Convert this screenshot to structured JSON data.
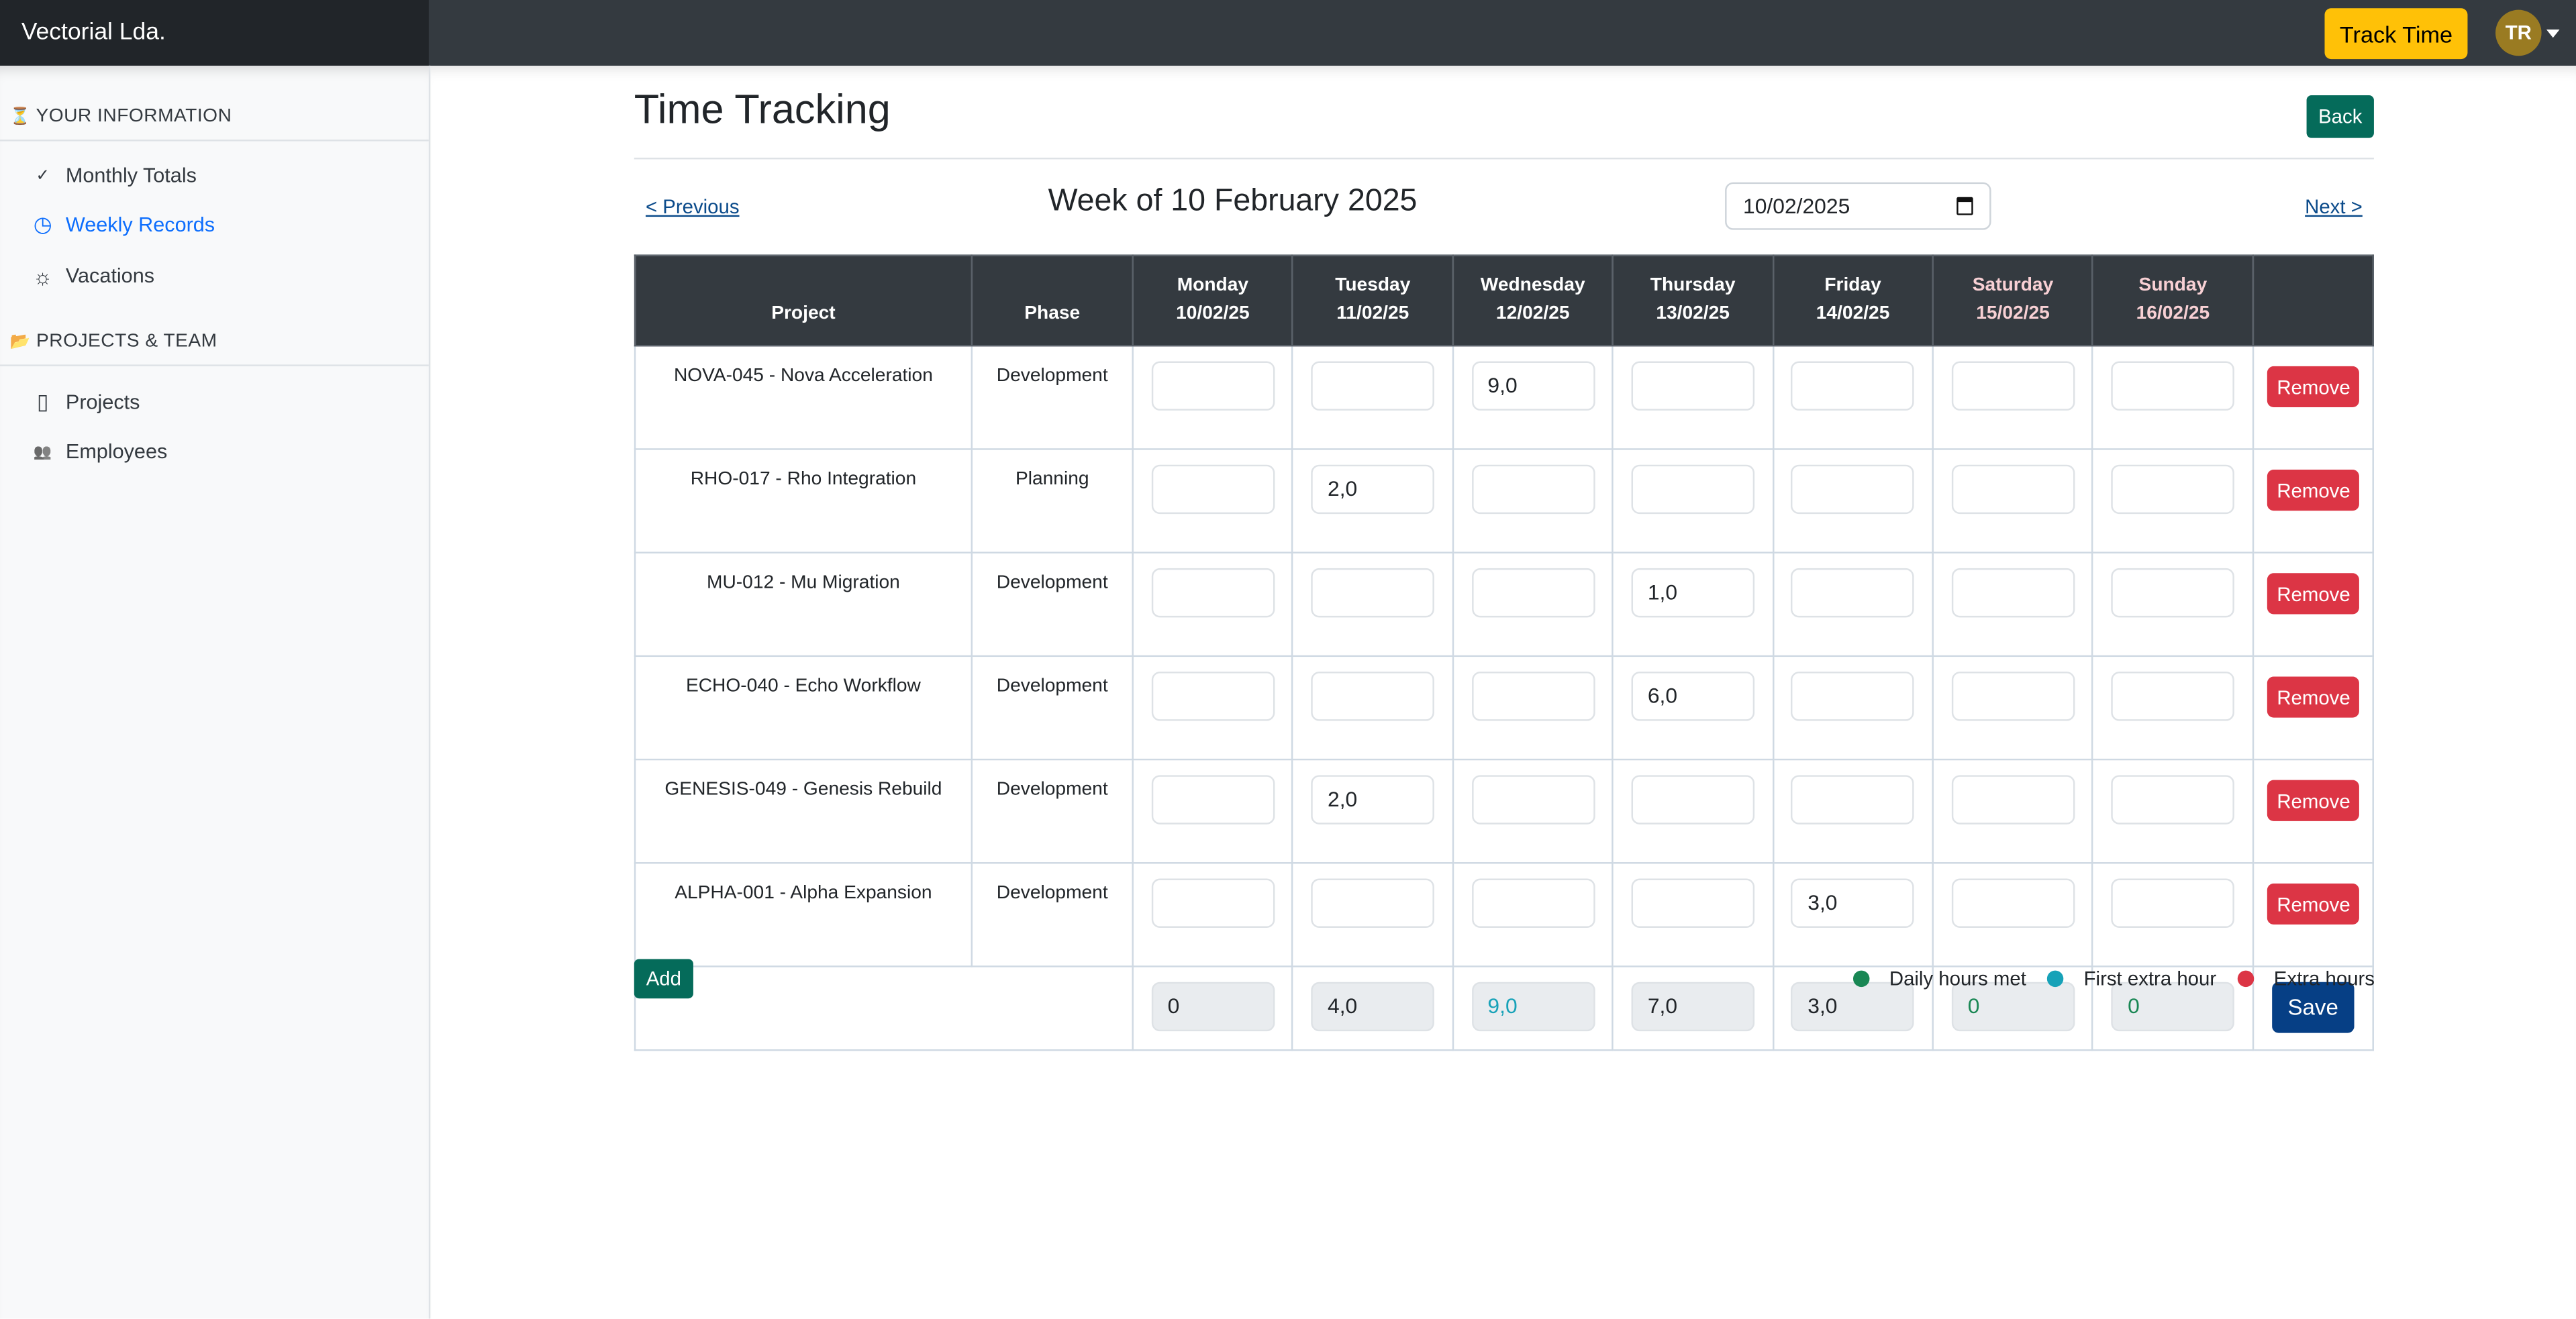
{
  "app": {
    "brand": "Vectorial Lda.",
    "track_time_label": "Track Time",
    "user_initials": "TR"
  },
  "sidebar": {
    "sections": [
      {
        "icon": "hourglass-icon",
        "glyph": "⏳",
        "title": "YOUR INFORMATION",
        "items": [
          {
            "label": "Monthly Totals",
            "icon": "check-icon",
            "glyph": "✓",
            "active": false
          },
          {
            "label": "Weekly Records",
            "icon": "clock-icon",
            "glyph": "◷",
            "active": true
          },
          {
            "label": "Vacations",
            "icon": "sun-icon",
            "glyph": "☼",
            "active": false
          }
        ]
      },
      {
        "icon": "folder-icon",
        "glyph": "📂",
        "title": "PROJECTS & TEAM",
        "items": [
          {
            "label": "Projects",
            "icon": "clipboard-icon",
            "glyph": "▯",
            "active": false
          },
          {
            "label": "Employees",
            "icon": "people-icon",
            "glyph": "👥",
            "active": false
          }
        ]
      }
    ]
  },
  "page": {
    "title": "Time Tracking",
    "back_label": "Back",
    "prev_label": "< Previous",
    "next_label": "Next >",
    "week_title": "Week of 10 February 2025",
    "date_value": "10/02/2025"
  },
  "table": {
    "headers": {
      "project": "Project",
      "phase": "Phase",
      "days": [
        {
          "name": "Monday",
          "date": "10/02/25",
          "weekend": false
        },
        {
          "name": "Tuesday",
          "date": "11/02/25",
          "weekend": false
        },
        {
          "name": "Wednesday",
          "date": "12/02/25",
          "weekend": false
        },
        {
          "name": "Thursday",
          "date": "13/02/25",
          "weekend": false
        },
        {
          "name": "Friday",
          "date": "14/02/25",
          "weekend": false
        },
        {
          "name": "Saturday",
          "date": "15/02/25",
          "weekend": true
        },
        {
          "name": "Sunday",
          "date": "16/02/25",
          "weekend": true
        }
      ]
    },
    "rows": [
      {
        "project": "NOVA-045 - Nova Acceleration",
        "phase": "Development",
        "hours": [
          "",
          "",
          "9,0",
          "",
          "",
          "",
          ""
        ]
      },
      {
        "project": "RHO-017 - Rho Integration",
        "phase": "Planning",
        "hours": [
          "",
          "2,0",
          "",
          "",
          "",
          "",
          ""
        ]
      },
      {
        "project": "MU-012 - Mu Migration",
        "phase": "Development",
        "hours": [
          "",
          "",
          "",
          "1,0",
          "",
          "",
          ""
        ]
      },
      {
        "project": "ECHO-040 - Echo Workflow",
        "phase": "Development",
        "hours": [
          "",
          "",
          "",
          "6,0",
          "",
          "",
          ""
        ]
      },
      {
        "project": "GENESIS-049 - Genesis Rebuild",
        "phase": "Development",
        "hours": [
          "",
          "2,0",
          "",
          "",
          "",
          "",
          ""
        ]
      },
      {
        "project": "ALPHA-001 - Alpha Expansion",
        "phase": "Development",
        "hours": [
          "",
          "",
          "",
          "",
          "3,0",
          "",
          ""
        ]
      }
    ],
    "remove_label": "Remove",
    "totals": [
      {
        "value": "0",
        "status": "none"
      },
      {
        "value": "4,0",
        "status": "none"
      },
      {
        "value": "9,0",
        "status": "first-extra"
      },
      {
        "value": "7,0",
        "status": "none"
      },
      {
        "value": "3,0",
        "status": "none"
      },
      {
        "value": "0",
        "status": "met"
      },
      {
        "value": "0",
        "status": "met"
      }
    ],
    "save_label": "Save"
  },
  "add_label": "Add",
  "legend": [
    {
      "label": "Daily hours met",
      "color": "#198754",
      "status": "met"
    },
    {
      "label": "First extra hour",
      "color": "#17a2b8",
      "status": "first-extra"
    },
    {
      "label": "Extra hours",
      "color": "#dc3545",
      "status": "extra"
    }
  ],
  "status_colors": {
    "none": "#212529",
    "met": "#198754",
    "first-extra": "#17a2b8",
    "extra": "#dc3545"
  }
}
